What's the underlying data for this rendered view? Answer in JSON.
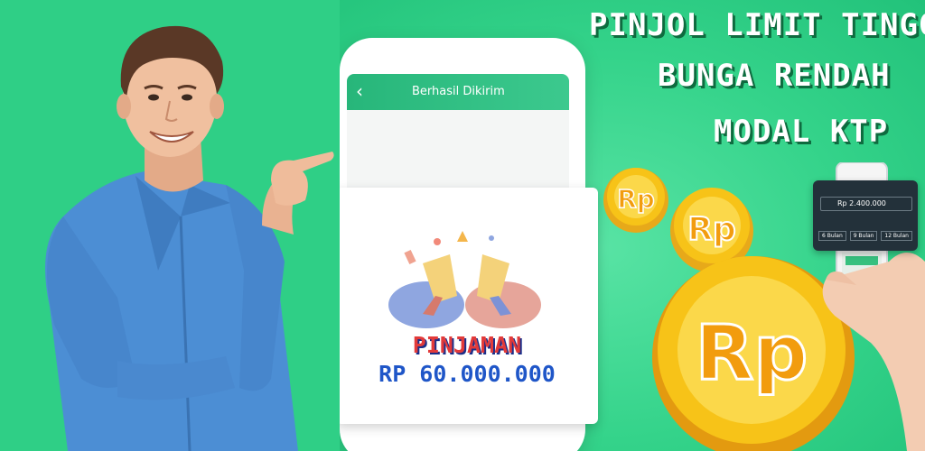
{
  "headlines": [
    "PINJOL LIMIT TINGGI",
    "BUNGA RENDAH",
    "MODAL KTP"
  ],
  "phone": {
    "back_glyph": "‹",
    "screen_title": "Berhasil Dikirim"
  },
  "loan_card": {
    "label": "PINJAMAN",
    "amount": "RP 60.000.000"
  },
  "coins": [
    "Rp",
    "Rp",
    "Rp"
  ],
  "mini_phone": {
    "amount": "Rp 2.400.000",
    "buttons": [
      "6 Bulan",
      "9 Bulan",
      "12 Bulan"
    ]
  },
  "colors": {
    "left_bg": "#2fcf86",
    "right_bg": "#34d38a",
    "headline_shadow": "#0e6b3f",
    "coin_gold": "#f7c318",
    "label_red": "#e23a3a",
    "amount_blue": "#1f56c8"
  }
}
